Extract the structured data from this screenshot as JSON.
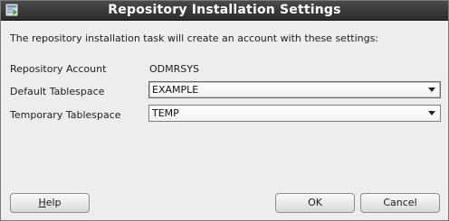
{
  "window": {
    "title": "Repository Installation Settings",
    "icon": "repository-app-icon"
  },
  "intro_text": "The repository installation task will create an account with these settings:",
  "fields": {
    "repository_account": {
      "label": "Repository Account",
      "value": "ODMRSYS"
    },
    "default_tablespace": {
      "label": "Default Tablespace",
      "value": "EXAMPLE"
    },
    "temporary_tablespace": {
      "label": "Temporary Tablespace",
      "value": "TEMP"
    }
  },
  "buttons": {
    "help_mnemonic": "H",
    "help_rest": "elp",
    "ok": "OK",
    "cancel": "Cancel"
  },
  "colors": {
    "titlebar": "#2c2c2c",
    "background": "#ededed",
    "title_text": "#ffffff"
  }
}
